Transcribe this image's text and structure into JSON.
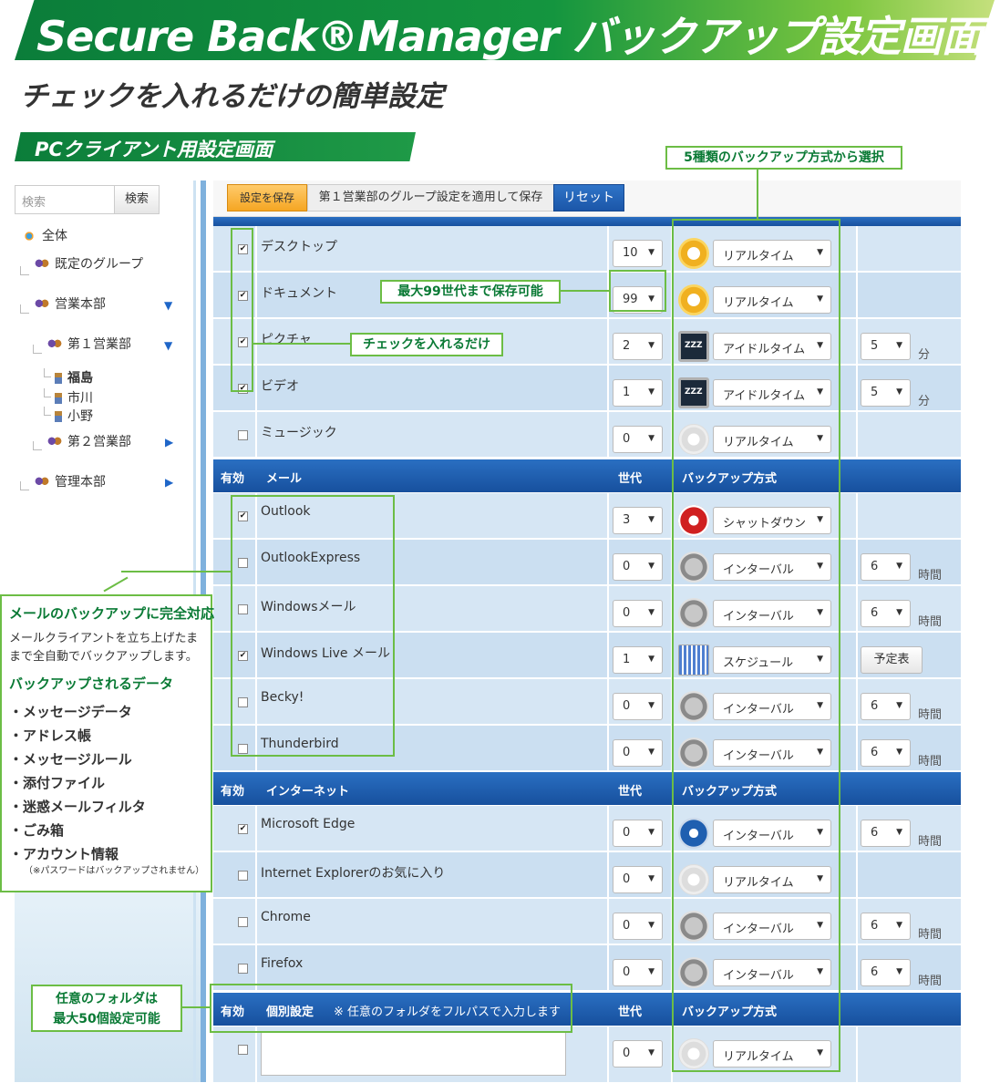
{
  "banner": {
    "title": "Secure Back®Manager バックアップ設定画面"
  },
  "subtitle": "チェックを入れるだけの簡単設定",
  "section_tab": "PCクライアント用設定画面",
  "search": {
    "placeholder": "検索",
    "button": "検索"
  },
  "tree": {
    "all": "全体",
    "default_group": "既定のグループ",
    "sales_hq": "営業本部",
    "sales1": "第１営業部",
    "fukushima": "福島",
    "ichikawa": "市川",
    "ono": "小野",
    "sales2": "第２営業部",
    "admin_hq": "管理本部"
  },
  "toolbar": {
    "save": "設定を保存",
    "group_save": "第１営業部のグループ設定を適用して保存",
    "reset": "リセット"
  },
  "headers": {
    "enabled": "有効",
    "gen": "世代",
    "method": "バックアップ方式",
    "mail": "メール",
    "internet": "インターネット",
    "custom": "個別設定",
    "custom_note": "※ 任意のフォルダをフルパスで入力します"
  },
  "folders": [
    {
      "name": "デスクトップ",
      "checked": true,
      "gen": "10",
      "mode": "リアルタイム",
      "icon": "realtime-icon"
    },
    {
      "name": "ドキュメント",
      "checked": true,
      "gen": "99",
      "mode": "リアルタイム",
      "icon": "realtime-icon"
    },
    {
      "name": "ピクチャ",
      "checked": true,
      "gen": "2",
      "mode": "アイドルタイム",
      "icon": "idle-icon",
      "extra": "5",
      "unit": "分"
    },
    {
      "name": "ビデオ",
      "checked": true,
      "gen": "1",
      "mode": "アイドルタイム",
      "icon": "idle-icon",
      "extra": "5",
      "unit": "分"
    },
    {
      "name": "ミュージック",
      "checked": false,
      "gen": "0",
      "mode": "リアルタイム",
      "icon": "realtime-off-icon"
    }
  ],
  "mail": [
    {
      "name": "Outlook",
      "checked": true,
      "gen": "3",
      "mode": "シャットダウン",
      "icon": "shutdown-icon"
    },
    {
      "name": "OutlookExpress",
      "checked": false,
      "gen": "0",
      "mode": "インターバル",
      "icon": "interval-icon",
      "extra": "6",
      "unit": "時間"
    },
    {
      "name": "Windowsメール",
      "checked": false,
      "gen": "0",
      "mode": "インターバル",
      "icon": "interval-icon",
      "extra": "6",
      "unit": "時間"
    },
    {
      "name": "Windows Live メール",
      "checked": true,
      "gen": "1",
      "mode": "スケジュール",
      "icon": "schedule-icon",
      "button": "予定表"
    },
    {
      "name": "Becky!",
      "checked": false,
      "gen": "0",
      "mode": "インターバル",
      "icon": "interval-icon",
      "extra": "6",
      "unit": "時間"
    },
    {
      "name": "Thunderbird",
      "checked": false,
      "gen": "0",
      "mode": "インターバル",
      "icon": "interval-icon",
      "extra": "6",
      "unit": "時間"
    }
  ],
  "internet": [
    {
      "name": "Microsoft Edge",
      "checked": true,
      "gen": "0",
      "mode": "インターバル",
      "icon": "interval-blue-icon",
      "extra": "6",
      "unit": "時間"
    },
    {
      "name": "Internet Explorerのお気に入り",
      "checked": false,
      "gen": "0",
      "mode": "リアルタイム",
      "icon": "realtime-off-icon"
    },
    {
      "name": "Chrome",
      "checked": false,
      "gen": "0",
      "mode": "インターバル",
      "icon": "interval-icon",
      "extra": "6",
      "unit": "時間"
    },
    {
      "name": "Firefox",
      "checked": false,
      "gen": "0",
      "mode": "インターバル",
      "icon": "interval-icon",
      "extra": "6",
      "unit": "時間"
    }
  ],
  "custom_row": {
    "checked": false,
    "gen": "0",
    "mode": "リアルタイム"
  },
  "callouts": {
    "methods": "5種類のバックアップ方式から選択",
    "gen99": "最大99世代まで保存可能",
    "check": "チェックを入れるだけ",
    "folder50_1": "任意のフォルダは",
    "folder50_2": "最大50個設定可能"
  },
  "info": {
    "title": "メールのバックアップに完全対応",
    "desc": "メールクライアントを立ち上げたままで全自動でバックアップします。",
    "list_title": "バックアップされるデータ",
    "items": [
      "・メッセージデータ",
      "・アドレス帳",
      "・メッセージルール",
      "・添付ファイル",
      "・迷惑メールフィルタ",
      "・ごみ箱",
      "・アカウント情報"
    ],
    "note": "（※パスワードはバックアップされません）"
  }
}
